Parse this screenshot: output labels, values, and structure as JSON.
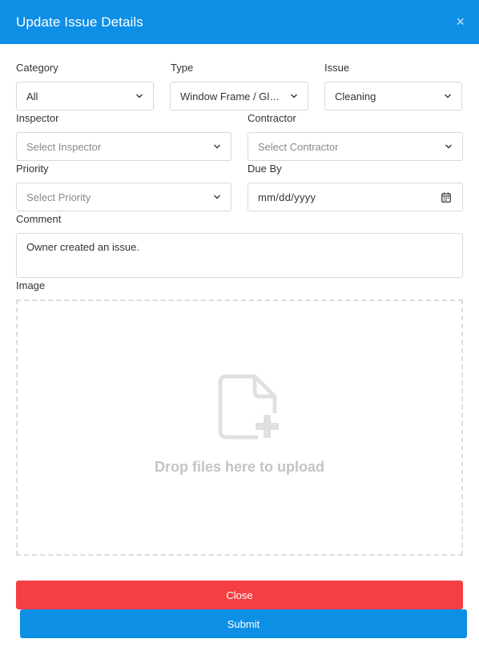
{
  "modal": {
    "title": "Update Issue Details",
    "close_glyph": "×"
  },
  "fields": {
    "category": {
      "label": "Category",
      "value": "All"
    },
    "type": {
      "label": "Type",
      "value": "Window Frame / Glass"
    },
    "issue": {
      "label": "Issue",
      "value": "Cleaning"
    },
    "inspector": {
      "label": "Inspector",
      "placeholder": "Select Inspector"
    },
    "contractor": {
      "label": "Contractor",
      "placeholder": "Select Contractor"
    },
    "priority": {
      "label": "Priority",
      "placeholder": "Select Priority"
    },
    "due_by": {
      "label": "Due By",
      "placeholder": "mm/dd/yyyy"
    },
    "comment": {
      "label": "Comment",
      "value": "Owner created an issue."
    },
    "image": {
      "label": "Image",
      "drop_text": "Drop files here to upload"
    }
  },
  "buttons": {
    "close": "Close",
    "submit": "Submit"
  },
  "colors": {
    "header": "#0d8fe6",
    "close_button": "#f43f43",
    "submit_button": "#0d8fe6"
  },
  "icons": {
    "dropdown": "chevron-down-icon",
    "date": "calendar-icon",
    "upload": "file-add-icon",
    "dismiss": "close-icon"
  }
}
